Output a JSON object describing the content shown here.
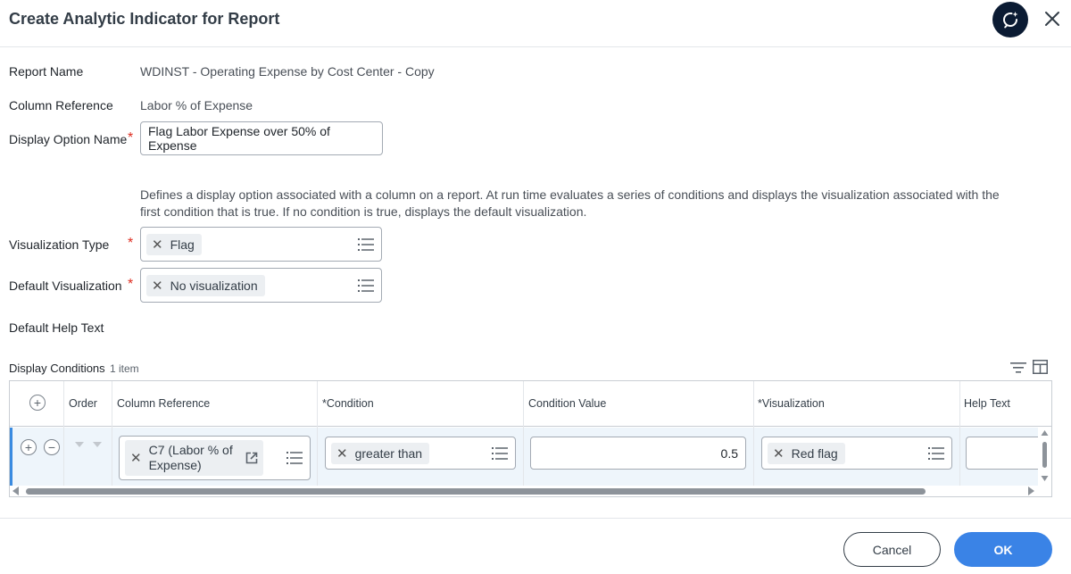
{
  "header": {
    "title": "Create Analytic Indicator for Report"
  },
  "fields": {
    "report_name": {
      "label": "Report Name",
      "value": "WDINST - Operating Expense by Cost Center - Copy"
    },
    "column_reference": {
      "label": "Column Reference",
      "value": "Labor % of Expense"
    },
    "display_option_name": {
      "label": "Display Option Name",
      "required_mark": "*",
      "value": "Flag Labor Expense over 50% of Expense"
    },
    "description": "Defines a display option associated with a column on a report. At run time evaluates a series of conditions and displays the visualization associated with the first condition that is true. If no condition is true, displays the default visualization.",
    "visualization_type": {
      "label": "Visualization Type",
      "required_mark": "*",
      "selected": "Flag"
    },
    "default_visualization": {
      "label": "Default Visualization",
      "required_mark": "*",
      "selected": "No visualization"
    },
    "default_help_text": {
      "label": "Default Help Text"
    }
  },
  "display_conditions": {
    "title": "Display Conditions",
    "count": "1 item",
    "columns": {
      "order": "Order",
      "column_reference": "Column Reference",
      "condition": "*Condition",
      "condition_value": "Condition Value",
      "visualization": "*Visualization",
      "help_text": "Help Text"
    },
    "rows": [
      {
        "column_reference": "C7 (Labor % of Expense)",
        "column_reference_line1": "C7 (Labor % of",
        "column_reference_line2": "Expense)",
        "condition": "greater than",
        "condition_value": "0.5",
        "visualization": "Red flag",
        "help_text": ""
      }
    ]
  },
  "footer": {
    "cancel_label": "Cancel",
    "ok_label": "OK"
  },
  "colors": {
    "primary": "#3a83e6",
    "required": "#de2e21",
    "assistant_bg": "#0b1b33"
  },
  "icons": [
    "assistant-sparkle-icon",
    "close-icon",
    "list-icon",
    "add-icon",
    "remove-icon",
    "filter-icon",
    "column-layout-icon",
    "external-link-icon"
  ]
}
